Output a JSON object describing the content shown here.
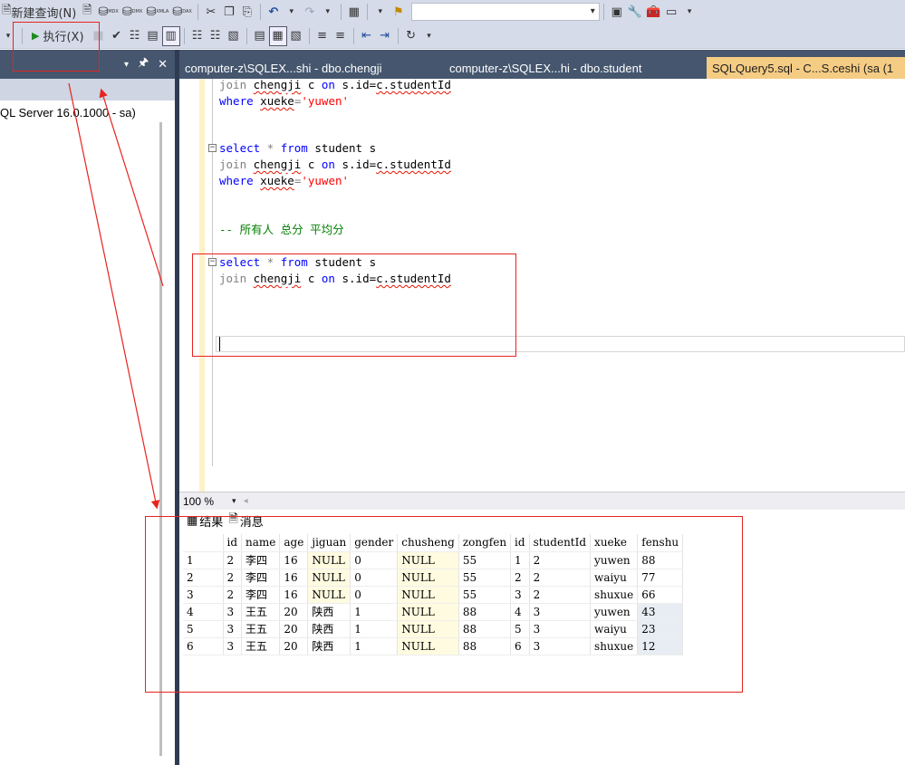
{
  "toolbar1": {
    "new_query_label": "新建查询(N)",
    "query_icons_labels": [
      "MDX",
      "DMX",
      "XMLA",
      "DAX"
    ]
  },
  "toolbar2": {
    "execute_label": "执行(X)"
  },
  "object_explorer": {
    "server_label": "QL Server 16.0.1000 - sa)"
  },
  "tabs": [
    {
      "label": "computer-z\\SQLEX...shi - dbo.chengji"
    },
    {
      "label": "computer-z\\SQLEX...hi - dbo.student"
    },
    {
      "label": "SQLQuery5.sql - C...S.ceshi (sa (1"
    }
  ],
  "editor": {
    "lines": {
      "l1_join": "join",
      "l1_table": "chengji",
      "l1_mid": " c ",
      "l1_on": "on",
      "l1_cond1": " s.id=",
      "l1_cond2": "c.studentId",
      "l2_where": "where",
      "l2_col": "xueke",
      "l2_eq": "=",
      "l2_val": "'yuwen'",
      "l3_select": "select",
      "l3_star": " * ",
      "l3_from": "from",
      "l3_rest": " student s",
      "comment": "-- 所有人 总分 平均分"
    }
  },
  "zoom": {
    "value": "100 %"
  },
  "results": {
    "tab_results": "结果",
    "tab_messages": "消息",
    "columns": [
      "id",
      "name",
      "age",
      "jiguan",
      "gender",
      "chusheng",
      "zongfen",
      "id",
      "studentId",
      "xueke",
      "fenshu"
    ],
    "rows": [
      [
        "1",
        "2",
        "李四",
        "16",
        "NULL",
        "0",
        "NULL",
        "55",
        "1",
        "2",
        "yuwen",
        "88"
      ],
      [
        "2",
        "2",
        "李四",
        "16",
        "NULL",
        "0",
        "NULL",
        "55",
        "2",
        "2",
        "waiyu",
        "77"
      ],
      [
        "3",
        "2",
        "李四",
        "16",
        "NULL",
        "0",
        "NULL",
        "55",
        "3",
        "2",
        "shuxue",
        "66"
      ],
      [
        "4",
        "3",
        "王五",
        "20",
        "陕西",
        "1",
        "NULL",
        "88",
        "4",
        "3",
        "yuwen",
        "43"
      ],
      [
        "5",
        "3",
        "王五",
        "20",
        "陕西",
        "1",
        "NULL",
        "88",
        "5",
        "3",
        "waiyu",
        "23"
      ],
      [
        "6",
        "3",
        "王五",
        "20",
        "陕西",
        "1",
        "NULL",
        "88",
        "6",
        "3",
        "shuxue",
        "12"
      ]
    ]
  },
  "colors": {
    "annotation": "#e8231e",
    "active_tab": "#f5cc84",
    "chrome_dark": "#45566e"
  }
}
